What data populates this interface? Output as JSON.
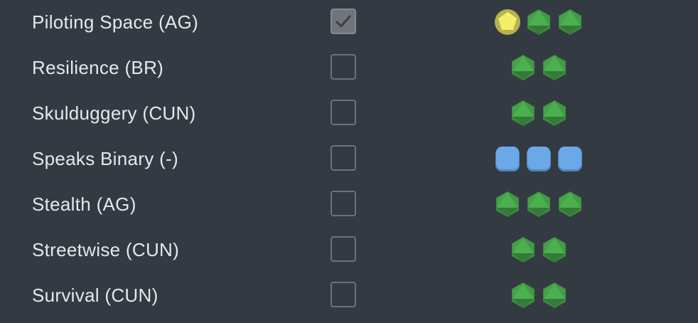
{
  "skills": [
    {
      "name": "Piloting Space (AG)",
      "career": true,
      "dice": [
        "proficiency",
        "ability",
        "ability"
      ]
    },
    {
      "name": "Resilience (BR)",
      "career": false,
      "dice": [
        "ability",
        "ability"
      ]
    },
    {
      "name": "Skulduggery (CUN)",
      "career": false,
      "dice": [
        "ability",
        "ability"
      ]
    },
    {
      "name": "Speaks Binary (-)",
      "career": false,
      "dice": [
        "boost",
        "boost",
        "boost"
      ]
    },
    {
      "name": "Stealth (AG)",
      "career": false,
      "dice": [
        "ability",
        "ability",
        "ability"
      ]
    },
    {
      "name": "Streetwise (CUN)",
      "career": false,
      "dice": [
        "ability",
        "ability"
      ]
    },
    {
      "name": "Survival (CUN)",
      "career": false,
      "dice": [
        "ability",
        "ability"
      ]
    }
  ],
  "die_colors": {
    "ability": "#4caf50",
    "proficiency": "#f1ee6a",
    "boost": "#6aa8e8"
  },
  "checkbox_colors": {
    "checked_fill": "#71757a",
    "checkmark": "#3a3f45"
  }
}
